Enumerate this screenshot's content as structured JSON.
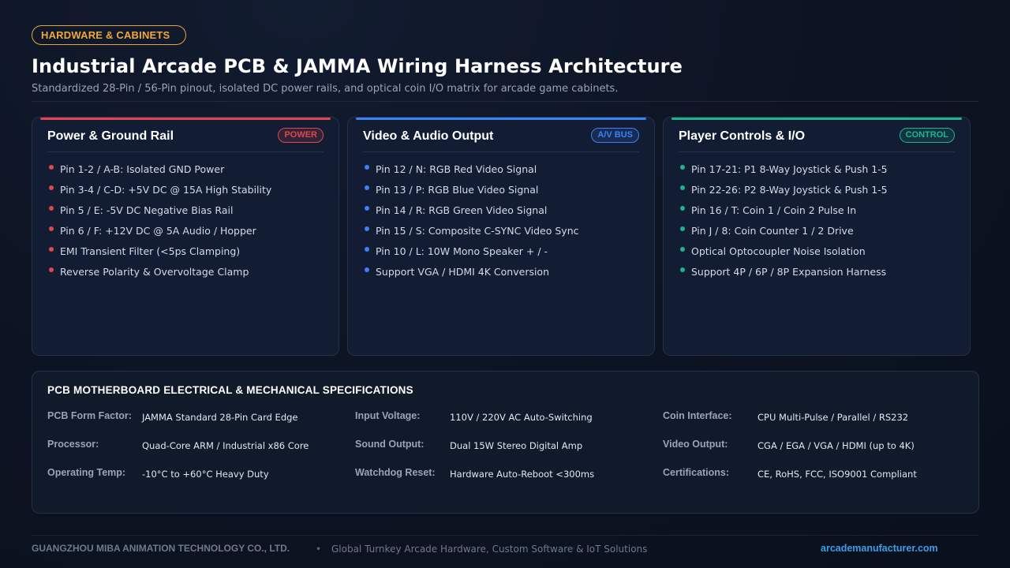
{
  "header": {
    "badge": "HARDWARE & CABINETS",
    "title": "Industrial Arcade PCB & JAMMA Wiring Harness Architecture",
    "subtitle": "Standardized 28-Pin / 56-Pin pinout, isolated DC power rails, and optical coin I/O matrix for arcade game cabinets."
  },
  "cards": [
    {
      "title": "Power & Ground Rail",
      "tag": "POWER",
      "accent": "#e0474c",
      "items": [
        "Pin 1-2 / A-B: Isolated GND Power",
        "Pin 3-4 / C-D: +5V DC @ 15A High Stability",
        "Pin 5 / E: -5V DC Negative Bias Rail",
        "Pin 6 / F: +12V DC @ 5A Audio / Hopper",
        "EMI Transient Filter (<5ps Clamping)",
        "Reverse Polarity & Overvoltage Clamp"
      ]
    },
    {
      "title": "Video & Audio Output",
      "tag": "A/V BUS",
      "accent": "#3b82f6",
      "items": [
        "Pin 12 / N: RGB Red Video Signal",
        "Pin 13 / P: RGB Blue Video Signal",
        "Pin 14 / R: RGB Green Video Signal",
        "Pin 15 / S: Composite C-SYNC Video Sync",
        "Pin 10 / L: 10W Mono Speaker + / -",
        "Support VGA / HDMI 4K Conversion"
      ]
    },
    {
      "title": "Player Controls & I/O",
      "tag": "CONTROL",
      "accent": "#1fb58a",
      "items": [
        "Pin 17-21: P1 8-Way Joystick & Push 1-5",
        "Pin 22-26: P2 8-Way Joystick & Push 1-5",
        "Pin 16 / T: Coin 1 / Coin 2 Pulse In",
        "Pin J / 8: Coin Counter 1 / 2 Drive",
        "Optical Optocoupler Noise Isolation",
        "Support 4P / 6P / 8P Expansion Harness"
      ]
    }
  ],
  "specs": {
    "title": "PCB MOTHERBOARD ELECTRICAL & MECHANICAL SPECIFICATIONS",
    "rows": [
      [
        {
          "label": "PCB Form Factor:",
          "value": "JAMMA Standard 28-Pin Card Edge"
        },
        {
          "label": "Input Voltage:",
          "value": "110V / 220V AC Auto-Switching"
        },
        {
          "label": "Coin Interface:",
          "value": "CPU Multi-Pulse / Parallel / RS232"
        }
      ],
      [
        {
          "label": "Processor:",
          "value": "Quad-Core ARM / Industrial x86 Core"
        },
        {
          "label": "Sound Output:",
          "value": "Dual 15W Stereo Digital Amp"
        },
        {
          "label": "Video Output:",
          "value": "CGA / EGA / VGA / HDMI (up to 4K)"
        }
      ],
      [
        {
          "label": "Operating Temp:",
          "value": "-10°C to +60°C Heavy Duty"
        },
        {
          "label": "Watchdog Reset:",
          "value": "Hardware Auto-Reboot <300ms"
        },
        {
          "label": "Certifications:",
          "value": "CE, RoHS, FCC, ISO9001 Compliant"
        }
      ]
    ]
  },
  "footer": {
    "company": "GUANGZHOU MIBA ANIMATION TECHNOLOGY CO., LTD.",
    "separator": "•",
    "tagline": "Global Turnkey Arcade Hardware, Custom Software & IoT Solutions",
    "url": "arcademanufacturer.com"
  }
}
